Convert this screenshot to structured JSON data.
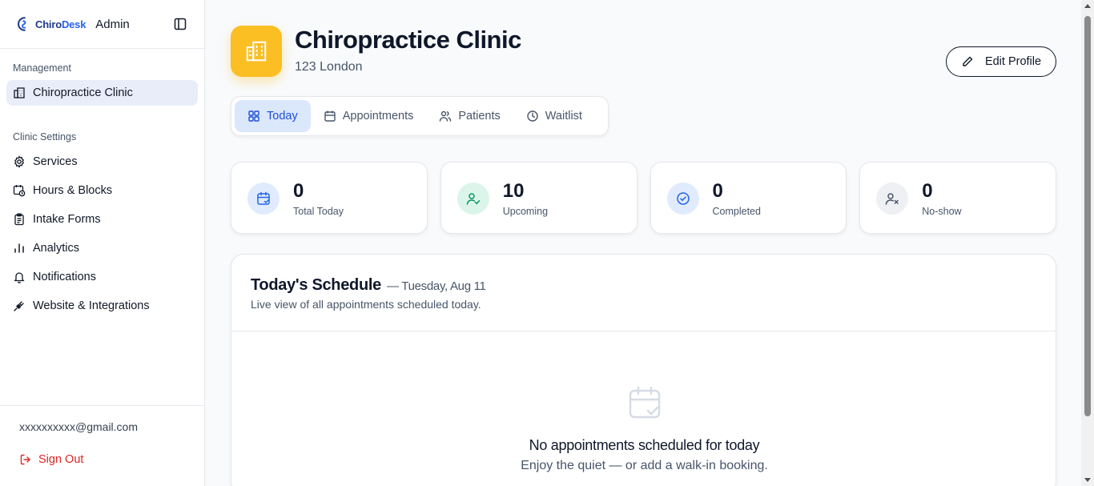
{
  "brand": {
    "name_part1": "Chiro",
    "name_part2": "Desk",
    "role": "Admin"
  },
  "sidebar": {
    "management_label": "Management",
    "management_items": [
      {
        "label": "Chiropractice Clinic",
        "icon": "building-icon",
        "active": true
      }
    ],
    "settings_label": "Clinic Settings",
    "settings_items": [
      {
        "label": "Services",
        "icon": "gear-icon"
      },
      {
        "label": "Hours & Blocks",
        "icon": "calendar-clock-icon"
      },
      {
        "label": "Intake Forms",
        "icon": "clipboard-icon"
      },
      {
        "label": "Analytics",
        "icon": "bar-chart-icon"
      },
      {
        "label": "Notifications",
        "icon": "bell-icon"
      },
      {
        "label": "Website & Integrations",
        "icon": "plug-icon"
      }
    ],
    "user_email": "xxxxxxxxxx@gmail.com",
    "sign_out_label": "Sign Out"
  },
  "header": {
    "clinic_name": "Chiropractice Clinic",
    "address": "123 London",
    "edit_profile_label": "Edit Profile"
  },
  "tabs": [
    {
      "label": "Today",
      "icon": "grid-icon",
      "active": true
    },
    {
      "label": "Appointments",
      "icon": "calendar-icon"
    },
    {
      "label": "Patients",
      "icon": "users-icon"
    },
    {
      "label": "Waitlist",
      "icon": "clock-icon"
    }
  ],
  "stats": [
    {
      "value": "0",
      "label": "Total Today",
      "icon": "calendar-check-icon",
      "color": "#2563eb",
      "bg": "#e0ebfd"
    },
    {
      "value": "10",
      "label": "Upcoming",
      "icon": "user-check-icon",
      "color": "#059669",
      "bg": "#dcf5ea"
    },
    {
      "value": "0",
      "label": "Completed",
      "icon": "check-circle-icon",
      "color": "#2563eb",
      "bg": "#e0ebfd"
    },
    {
      "value": "0",
      "label": "No-show",
      "icon": "user-x-icon",
      "color": "#475569",
      "bg": "#eef0f3"
    }
  ],
  "schedule": {
    "title": "Today's Schedule",
    "date": "— Tuesday, Aug 11",
    "subtitle": "Live view of all appointments scheduled today.",
    "empty_title": "No appointments scheduled for today",
    "empty_subtitle": "Enjoy the quiet — or add a walk-in booking."
  },
  "colors": {
    "accent": "#2563eb",
    "clinic_icon_bg": "#fbbf24",
    "danger": "#dc2626",
    "active_nav_bg": "#e8edf9"
  }
}
